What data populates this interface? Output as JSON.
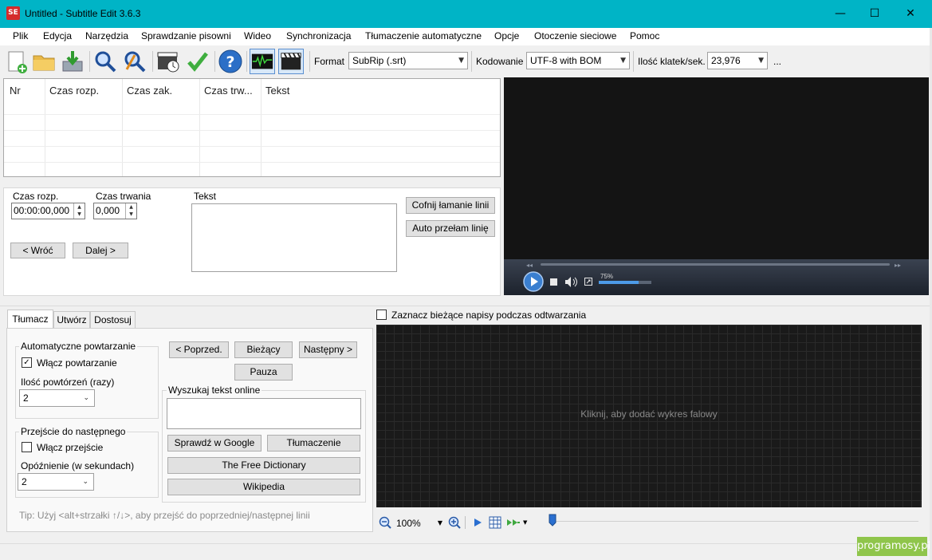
{
  "window": {
    "title": "Untitled - Subtitle Edit 3.6.3",
    "app_icon": "SE",
    "minimize": "—",
    "maximize": "☐",
    "close": "✕",
    "title_bar_color": "#00b4c6"
  },
  "menu": [
    "Plik",
    "Edycja",
    "Narzędzia",
    "Sprawdzanie pisowni",
    "Wideo",
    "Synchronizacja",
    "Tłumaczenie automatyczne",
    "Opcje",
    "Otoczenie sieciowe",
    "Pomoc"
  ],
  "toolbar": {
    "icons": [
      "new-file-icon",
      "open-folder-icon",
      "save-download-icon",
      "find-icon",
      "replace-icon",
      "visual-sync-icon",
      "spellcheck-icon",
      "help-icon",
      "waveform-toggle-icon",
      "video-toggle-icon"
    ],
    "format_label": "Format",
    "format_value": "SubRip (.srt)",
    "encoding_label": "Kodowanie",
    "encoding_value": "UTF-8 with BOM",
    "fps_label": "Ilość klatek/sek.",
    "fps_value": "23,976",
    "more": "..."
  },
  "list": {
    "columns": [
      "Nr",
      "Czas rozp.",
      "Czas zak.",
      "Czas trw...",
      "Tekst"
    ]
  },
  "edit": {
    "start_label": "Czas rozp.",
    "start_value": "00:00:00,000",
    "duration_label": "Czas trwania",
    "duration_value": "0,000",
    "text_label": "Tekst",
    "unbreak_button": "Cofnij łamanie linii",
    "autobreak_button": "Auto przełam linię",
    "prev_button": "< Wróć",
    "next_button": "Dalej >"
  },
  "player": {
    "volume_label": "75%",
    "volume_level": 0.75
  },
  "tabs": [
    "Tłumacz",
    "Utwórz",
    "Dostosuj"
  ],
  "translate": {
    "auto_repeat_group": "Automatyczne powtarzanie",
    "auto_repeat_check": "Włącz powtarzanie",
    "auto_repeat_checked": true,
    "repeat_count_label": "Ilość powtórzeń (razy)",
    "repeat_count_value": "2",
    "next_group": "Przejście do następnego",
    "next_check": "Włącz przejście",
    "next_checked": false,
    "delay_label": "Opóźnienie (w sekundach)",
    "delay_value": "2",
    "prev_btn": "< Poprzed.",
    "current_btn": "Bieżący",
    "next_btn": "Następny >",
    "pause_btn": "Pauza",
    "search_group": "Wyszukaj tekst online",
    "google_btn": "Sprawdź w Google",
    "translate_btn": "Tłumaczenie",
    "dictionary_btn": "The Free Dictionary",
    "wikipedia_btn": "Wikipedia",
    "tip": "Tip: Użyj <alt+strzałki ↑/↓>, aby przejść do poprzedniej/następnej linii"
  },
  "waveform": {
    "select_current_label": "Zaznacz bieżące napisy podczas odtwarzania",
    "hint": "Kliknij, aby dodać wykres falowy",
    "zoom_value": "100%"
  },
  "watermark": "programosy.pl"
}
